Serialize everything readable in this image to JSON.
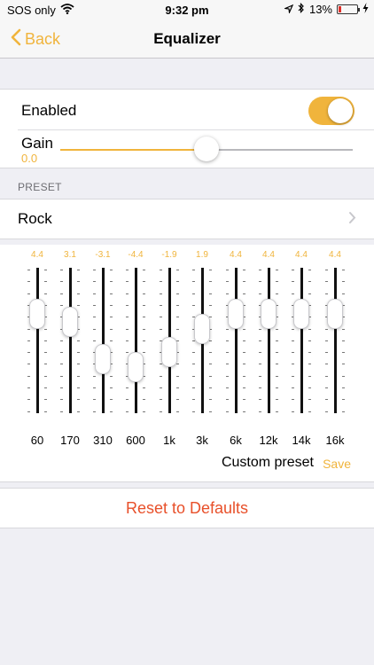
{
  "statusbar": {
    "carrier": "SOS only",
    "time": "9:32 pm",
    "battery": "13%"
  },
  "nav": {
    "back": "Back",
    "title": "Equalizer"
  },
  "settings": {
    "enabled_label": "Enabled",
    "enabled": true,
    "gain_label": "Gain",
    "gain_value": "0.0",
    "gain_level": 0.5
  },
  "preset": {
    "header": "PRESET",
    "value": "Rock"
  },
  "eq": {
    "range": [
      -12,
      12
    ],
    "bands": [
      {
        "freq": "60",
        "label": "4.4",
        "value": 4.4
      },
      {
        "freq": "170",
        "label": "3.1",
        "value": 3.1
      },
      {
        "freq": "310",
        "label": "-3.1",
        "value": -3.1
      },
      {
        "freq": "600",
        "label": "-4.4",
        "value": -4.4
      },
      {
        "freq": "1k",
        "label": "-1.9",
        "value": -1.9
      },
      {
        "freq": "3k",
        "label": "1.9",
        "value": 1.9
      },
      {
        "freq": "6k",
        "label": "4.4",
        "value": 4.4
      },
      {
        "freq": "12k",
        "label": "4.4",
        "value": 4.4
      },
      {
        "freq": "14k",
        "label": "4.4",
        "value": 4.4
      },
      {
        "freq": "16k",
        "label": "4.4",
        "value": 4.4
      }
    ],
    "custom_label": "Custom preset",
    "save_label": "Save"
  },
  "reset_label": "Reset to Defaults",
  "colors": {
    "accent": "#f0b43c",
    "destructive": "#e8502a",
    "battery_low": "#e0302a"
  },
  "icons": [
    "wifi-icon",
    "location-icon",
    "bluetooth-icon",
    "battery-icon",
    "charging-icon",
    "back-chevron-icon",
    "disclosure-chevron-icon"
  ]
}
